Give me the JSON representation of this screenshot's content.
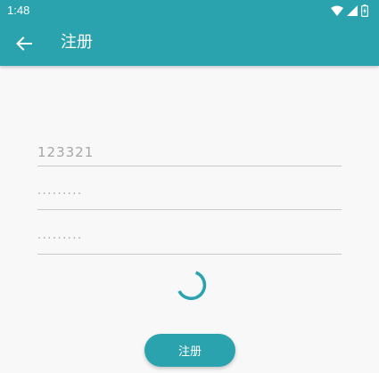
{
  "status_bar": {
    "time": "1:48",
    "icons": [
      "wifi-icon",
      "cell-signal-icon",
      "battery-charging-icon"
    ]
  },
  "app_bar": {
    "back_icon": "back-arrow-icon",
    "title": "注册"
  },
  "form": {
    "username_value": "123321",
    "password_mask": "·········",
    "confirm_password_mask": "·········"
  },
  "loading_indicator": {
    "visible": true
  },
  "register_button": {
    "label": "注册"
  },
  "colors": {
    "primary": "#2aa3ae",
    "background": "#f8f8f8",
    "field_text": "#a6a6a6",
    "underline": "#c9c9c9"
  }
}
